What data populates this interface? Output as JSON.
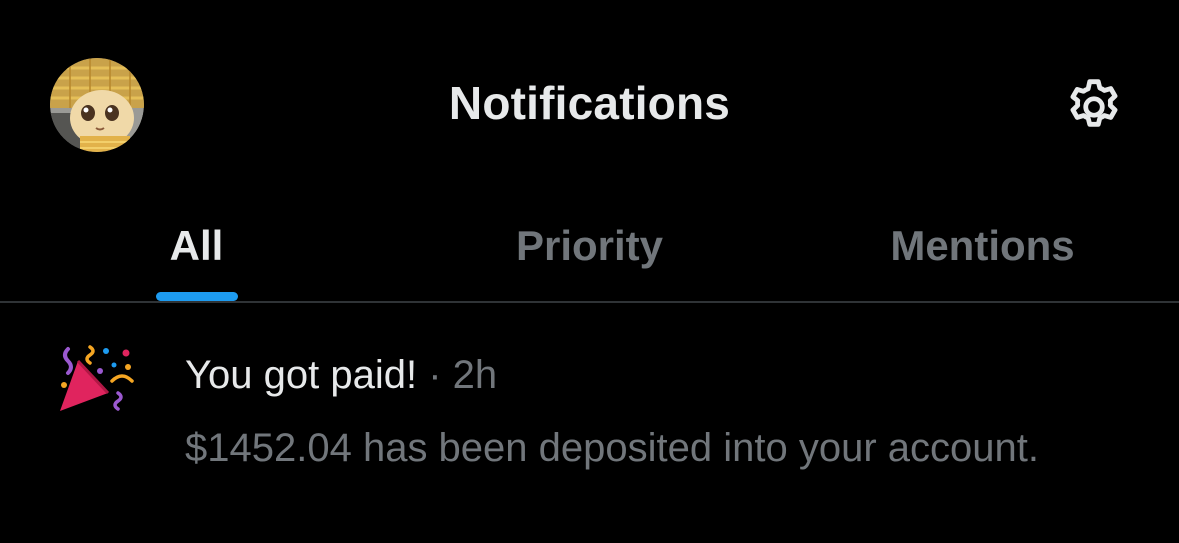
{
  "header": {
    "title": "Notifications",
    "avatar_icon": "avatar-image",
    "settings_icon": "gear-icon"
  },
  "tabs": [
    {
      "label": "All",
      "active": true
    },
    {
      "label": "Priority",
      "active": false
    },
    {
      "label": "Mentions",
      "active": false
    }
  ],
  "notification": {
    "icon": "party-popper-icon",
    "title": "You got paid!",
    "separator": "·",
    "time": "2h",
    "body": "$1452.04 has been deposited into your account."
  },
  "colors": {
    "background": "#000000",
    "text_primary": "#e7e9ea",
    "text_secondary": "#71767b",
    "accent": "#1d9bf0",
    "divider": "#2f3336"
  }
}
